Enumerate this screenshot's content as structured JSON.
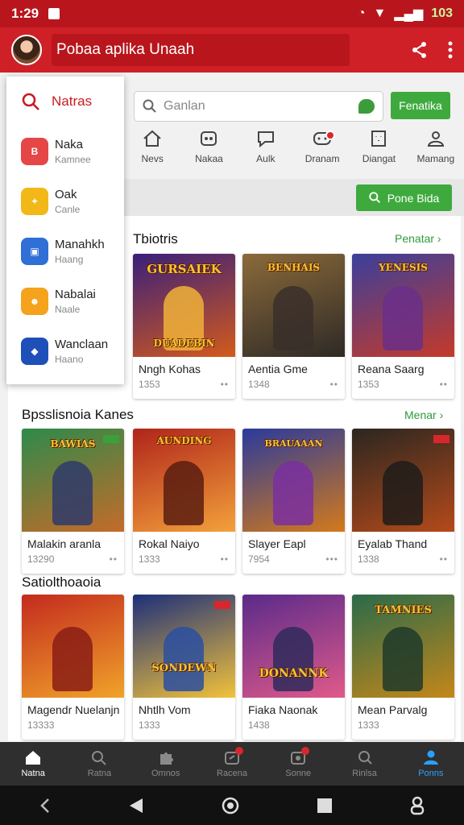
{
  "status_bar": {
    "time": "1:29",
    "battery": "103"
  },
  "app_bar": {
    "title": "Pobaa aplika Unaah"
  },
  "drawer": {
    "header": "Natras",
    "items": [
      {
        "title": "Naka",
        "subtitle": "Kamnee",
        "color": "#e54646"
      },
      {
        "title": "Oak",
        "subtitle": "Canle",
        "color": "#f2b817"
      },
      {
        "title": "Manahkh",
        "subtitle": "Haang",
        "color": "#2f6fd6"
      },
      {
        "title": "Nabalai",
        "subtitle": "Naale",
        "color": "#f5a21d"
      },
      {
        "title": "Wanclaan",
        "subtitle": "Haano",
        "color": "#1f4fb8"
      }
    ]
  },
  "search": {
    "placeholder": "Ganlan",
    "button": "Fenatika"
  },
  "categories": [
    {
      "label": "Nevs",
      "icon": "home-icon"
    },
    {
      "label": "Nakaa",
      "icon": "gamepad-icon"
    },
    {
      "label": "Aulk",
      "icon": "chat-icon"
    },
    {
      "label": "Dranam",
      "icon": "message-icon",
      "badge": true
    },
    {
      "label": "Diangat",
      "icon": "grid-icon"
    },
    {
      "label": "Mamang",
      "icon": "person-icon"
    }
  ],
  "promo_button": "Pone Bida",
  "sections": [
    {
      "title": "Tbiotris",
      "link": "Penatar",
      "cards": [
        {
          "name": "Nngh Kohas",
          "meta": "1353",
          "art": "GURSAIEK",
          "sub": "DUADEBIN",
          "c1": "#3a1f7a",
          "c2": "#d35a1c"
        },
        {
          "name": "Aentia Gme",
          "meta": "1348",
          "art": "BENHAIS",
          "sub": "",
          "c1": "#8b6a3a",
          "c2": "#2e2a26"
        },
        {
          "name": "Reana Saarg",
          "meta": "1353",
          "art": "YENESIS",
          "sub": "",
          "c1": "#3a3f9c",
          "c2": "#c43a2a"
        }
      ]
    },
    {
      "title": "Bpsslisnoia Kanes",
      "link": "Menar",
      "cards": [
        {
          "name": "Malakin aranla",
          "meta": "13290",
          "art": "BAWIAS",
          "sub": "",
          "c1": "#2e8a4a",
          "c2": "#c46b2a"
        },
        {
          "name": "Rokal Naiyo",
          "meta": "1333",
          "art": "AUNDING",
          "sub": "",
          "c1": "#b0241b",
          "c2": "#f3a13a"
        },
        {
          "name": "Slayer Eapl",
          "meta": "7954",
          "art": "BRAUAAAN",
          "sub": "",
          "c1": "#2a3a9c",
          "c2": "#d37a1a"
        },
        {
          "name": "Eyalab Thand",
          "meta": "1338",
          "art": "",
          "sub": "",
          "c1": "#2b2620",
          "c2": "#b44a1a"
        }
      ]
    },
    {
      "title": "Satiolthoaoia",
      "link": "",
      "cards": [
        {
          "name": "Magendr Nuelanjn",
          "meta": "13333",
          "art": "",
          "sub": "",
          "c1": "#c42a1e",
          "c2": "#f0a32a"
        },
        {
          "name": "Nhtlh Vom",
          "meta": "1333",
          "art": "SONDEWN",
          "sub": "",
          "c1": "#1d2f7a",
          "c2": "#f2c23a"
        },
        {
          "name": "Fiaka Naonak",
          "meta": "1438",
          "art": "DONANNK",
          "sub": "",
          "c1": "#5a2a8a",
          "c2": "#e05a8a"
        },
        {
          "name": "Mean Parvalg",
          "meta": "1333",
          "art": "TAMNIES",
          "sub": "",
          "c1": "#2a6a4a",
          "c2": "#c4871a"
        }
      ]
    }
  ],
  "bottom_nav": [
    {
      "label": "Natna",
      "icon": "home-icon"
    },
    {
      "label": "Ratna",
      "icon": "search-icon"
    },
    {
      "label": "Omnos",
      "icon": "puzzle-icon"
    },
    {
      "label": "Racena",
      "icon": "share-icon"
    },
    {
      "label": "Sonne",
      "icon": "camera-icon"
    },
    {
      "label": "Rinlsa",
      "icon": "zoom-icon"
    },
    {
      "label": "Ponns",
      "icon": "person-icon"
    }
  ]
}
